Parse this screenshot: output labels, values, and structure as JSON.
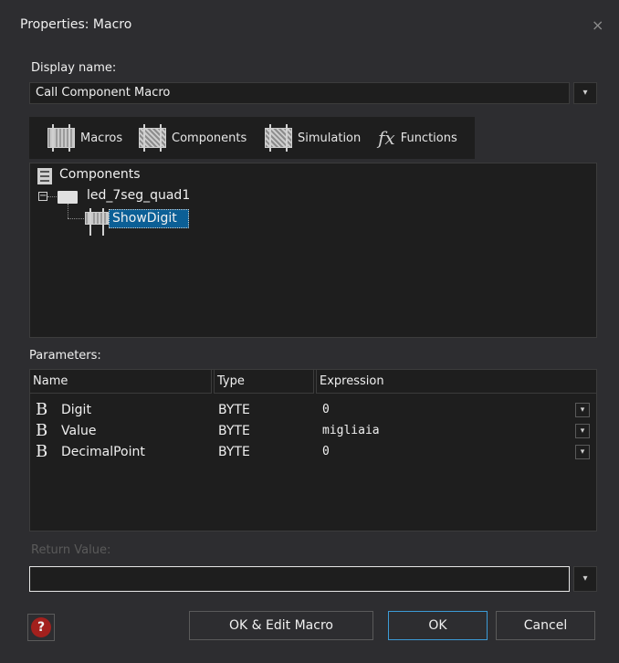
{
  "window": {
    "title": "Properties: Macro",
    "close_glyph": "×"
  },
  "display_name": {
    "label": "Display name:",
    "value": "Call Component Macro"
  },
  "tabs": [
    {
      "label": "Macros",
      "icon": "macros-icon"
    },
    {
      "label": "Components",
      "icon": "components-icon"
    },
    {
      "label": "Simulation",
      "icon": "simulation-icon"
    },
    {
      "label": "Functions",
      "icon": "functions-icon",
      "glyph": "fx"
    }
  ],
  "tree": {
    "root": "Components",
    "component": "led_7seg_quad1",
    "selected_macro": "ShowDigit",
    "expander": "−"
  },
  "parameters": {
    "label": "Parameters:",
    "columns": [
      "Name",
      "Type",
      "Expression"
    ],
    "rows": [
      {
        "type_glyph": "B",
        "name": "Digit",
        "type": "BYTE",
        "expression": "0"
      },
      {
        "type_glyph": "B",
        "name": "Value",
        "type": "BYTE",
        "expression": "migliaia"
      },
      {
        "type_glyph": "B",
        "name": "DecimalPoint",
        "type": "BYTE",
        "expression": "0"
      }
    ]
  },
  "return_value": {
    "label": "Return Value:",
    "value": ""
  },
  "dropdown_glyph": "▾",
  "buttons": {
    "help": "?",
    "ok_edit": "OK & Edit Macro",
    "ok": "OK",
    "cancel": "Cancel"
  },
  "colors": {
    "selection": "#0b5f96",
    "focus_border": "#3c9bd6",
    "help_red": "#a3201d"
  }
}
